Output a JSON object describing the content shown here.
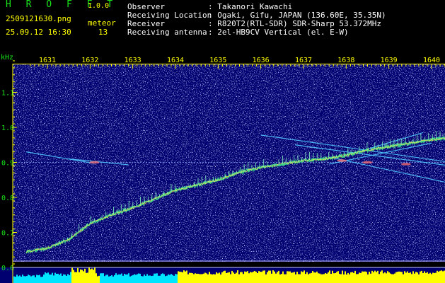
{
  "app": {
    "name": "H R O F F T",
    "version": "1.0.0"
  },
  "header": {
    "filename": "2509121630.png",
    "datetime": "25.09.12 16:30",
    "meteor_label": "meteor",
    "meteor_count": "13",
    "info": [
      {
        "label": "Observer",
        "value": ": Takanori Kawachi"
      },
      {
        "label": "Receiving Location",
        "value": ": Ogaki, Gifu, JAPAN (136.60E, 35.35N)"
      },
      {
        "label": "Receiver",
        "value": ": R820T2(RTL-SDR) SDR-Sharp 53.372MHz"
      },
      {
        "label": "Receiving antenna",
        "value": ": 2el-HB9CV Vertical (el. E-W)"
      }
    ]
  },
  "colors": {
    "green": "#19e619",
    "yellow": "#ffff00",
    "background": "#000066",
    "cyan": "#00e5ff"
  },
  "chart_data": {
    "type": "spectrogram",
    "xlabel": "",
    "ylabel": "kHz",
    "x_tick_labels": [
      "1631",
      "1632",
      "1633",
      "1634",
      "1635",
      "1636",
      "1637",
      "1638",
      "1639",
      "1640"
    ],
    "y_tick_labels": [
      "1.1",
      "1.0",
      "0.9",
      "0.8",
      "0.7",
      "0.6"
    ],
    "x_unit": "minute (hhmm)",
    "xlim_minutes": [
      1630.5,
      1640.45
    ],
    "ylim_khz": [
      0.58,
      1.2
    ],
    "main_trace": [
      {
        "x": 1630.5,
        "y": 0.645
      },
      {
        "x": 1631.0,
        "y": 0.655
      },
      {
        "x": 1631.5,
        "y": 0.68
      },
      {
        "x": 1632.0,
        "y": 0.725
      },
      {
        "x": 1632.5,
        "y": 0.75
      },
      {
        "x": 1633.0,
        "y": 0.77
      },
      {
        "x": 1633.5,
        "y": 0.795
      },
      {
        "x": 1634.0,
        "y": 0.82
      },
      {
        "x": 1634.5,
        "y": 0.835
      },
      {
        "x": 1635.0,
        "y": 0.85
      },
      {
        "x": 1635.5,
        "y": 0.872
      },
      {
        "x": 1636.0,
        "y": 0.885
      },
      {
        "x": 1636.5,
        "y": 0.895
      },
      {
        "x": 1637.0,
        "y": 0.905
      },
      {
        "x": 1637.5,
        "y": 0.91
      },
      {
        "x": 1638.0,
        "y": 0.92
      },
      {
        "x": 1638.5,
        "y": 0.935
      },
      {
        "x": 1639.0,
        "y": 0.945
      },
      {
        "x": 1639.5,
        "y": 0.955
      },
      {
        "x": 1640.0,
        "y": 0.965
      },
      {
        "x": 1640.45,
        "y": 0.97
      }
    ],
    "streaks": [
      {
        "name": "left-falling",
        "points": [
          {
            "x": 1630.5,
            "y": 0.93
          },
          {
            "x": 1632.1,
            "y": 0.897
          }
        ]
      },
      {
        "name": "left-mid",
        "points": [
          {
            "x": 1631.5,
            "y": 0.91
          },
          {
            "x": 1632.9,
            "y": 0.893
          }
        ]
      },
      {
        "name": "right-upper",
        "points": [
          {
            "x": 1636.0,
            "y": 0.978
          },
          {
            "x": 1640.45,
            "y": 0.9
          }
        ]
      },
      {
        "name": "right-middle",
        "points": [
          {
            "x": 1636.8,
            "y": 0.95
          },
          {
            "x": 1640.45,
            "y": 0.89
          }
        ]
      },
      {
        "name": "right-lower",
        "points": [
          {
            "x": 1637.6,
            "y": 0.915
          },
          {
            "x": 1640.45,
            "y": 0.84
          }
        ]
      },
      {
        "name": "right-rising-a",
        "points": [
          {
            "x": 1637.6,
            "y": 0.895
          },
          {
            "x": 1640.0,
            "y": 0.955
          }
        ]
      },
      {
        "name": "right-rising-b",
        "points": [
          {
            "x": 1638.0,
            "y": 0.92
          },
          {
            "x": 1639.8,
            "y": 0.985
          }
        ]
      }
    ],
    "reference_line_khz": 0.9
  }
}
